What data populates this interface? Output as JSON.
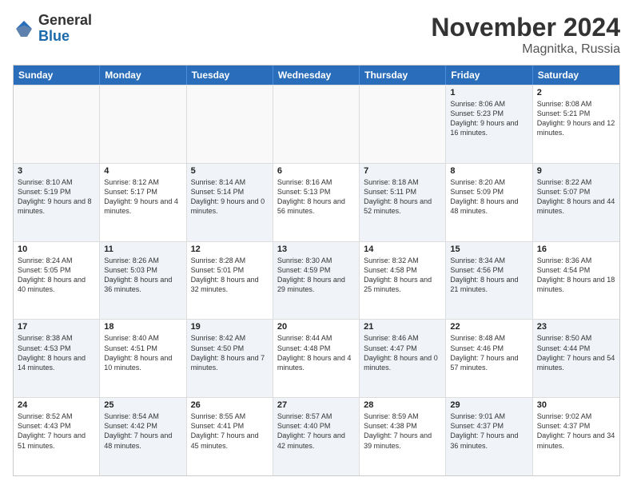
{
  "header": {
    "logo_general": "General",
    "logo_blue": "Blue",
    "month_title": "November 2024",
    "location": "Magnitka, Russia"
  },
  "weekdays": [
    "Sunday",
    "Monday",
    "Tuesday",
    "Wednesday",
    "Thursday",
    "Friday",
    "Saturday"
  ],
  "rows": [
    [
      {
        "day": "",
        "info": "",
        "empty": true
      },
      {
        "day": "",
        "info": "",
        "empty": true
      },
      {
        "day": "",
        "info": "",
        "empty": true
      },
      {
        "day": "",
        "info": "",
        "empty": true
      },
      {
        "day": "",
        "info": "",
        "empty": true
      },
      {
        "day": "1",
        "info": "Sunrise: 8:06 AM\nSunset: 5:23 PM\nDaylight: 9 hours and 16 minutes.",
        "shaded": true
      },
      {
        "day": "2",
        "info": "Sunrise: 8:08 AM\nSunset: 5:21 PM\nDaylight: 9 hours and 12 minutes.",
        "shaded": false
      }
    ],
    [
      {
        "day": "3",
        "info": "Sunrise: 8:10 AM\nSunset: 5:19 PM\nDaylight: 9 hours and 8 minutes.",
        "shaded": true
      },
      {
        "day": "4",
        "info": "Sunrise: 8:12 AM\nSunset: 5:17 PM\nDaylight: 9 hours and 4 minutes.",
        "shaded": false
      },
      {
        "day": "5",
        "info": "Sunrise: 8:14 AM\nSunset: 5:14 PM\nDaylight: 9 hours and 0 minutes.",
        "shaded": true
      },
      {
        "day": "6",
        "info": "Sunrise: 8:16 AM\nSunset: 5:13 PM\nDaylight: 8 hours and 56 minutes.",
        "shaded": false
      },
      {
        "day": "7",
        "info": "Sunrise: 8:18 AM\nSunset: 5:11 PM\nDaylight: 8 hours and 52 minutes.",
        "shaded": true
      },
      {
        "day": "8",
        "info": "Sunrise: 8:20 AM\nSunset: 5:09 PM\nDaylight: 8 hours and 48 minutes.",
        "shaded": false
      },
      {
        "day": "9",
        "info": "Sunrise: 8:22 AM\nSunset: 5:07 PM\nDaylight: 8 hours and 44 minutes.",
        "shaded": true
      }
    ],
    [
      {
        "day": "10",
        "info": "Sunrise: 8:24 AM\nSunset: 5:05 PM\nDaylight: 8 hours and 40 minutes.",
        "shaded": false
      },
      {
        "day": "11",
        "info": "Sunrise: 8:26 AM\nSunset: 5:03 PM\nDaylight: 8 hours and 36 minutes.",
        "shaded": true
      },
      {
        "day": "12",
        "info": "Sunrise: 8:28 AM\nSunset: 5:01 PM\nDaylight: 8 hours and 32 minutes.",
        "shaded": false
      },
      {
        "day": "13",
        "info": "Sunrise: 8:30 AM\nSunset: 4:59 PM\nDaylight: 8 hours and 29 minutes.",
        "shaded": true
      },
      {
        "day": "14",
        "info": "Sunrise: 8:32 AM\nSunset: 4:58 PM\nDaylight: 8 hours and 25 minutes.",
        "shaded": false
      },
      {
        "day": "15",
        "info": "Sunrise: 8:34 AM\nSunset: 4:56 PM\nDaylight: 8 hours and 21 minutes.",
        "shaded": true
      },
      {
        "day": "16",
        "info": "Sunrise: 8:36 AM\nSunset: 4:54 PM\nDaylight: 8 hours and 18 minutes.",
        "shaded": false
      }
    ],
    [
      {
        "day": "17",
        "info": "Sunrise: 8:38 AM\nSunset: 4:53 PM\nDaylight: 8 hours and 14 minutes.",
        "shaded": true
      },
      {
        "day": "18",
        "info": "Sunrise: 8:40 AM\nSunset: 4:51 PM\nDaylight: 8 hours and 10 minutes.",
        "shaded": false
      },
      {
        "day": "19",
        "info": "Sunrise: 8:42 AM\nSunset: 4:50 PM\nDaylight: 8 hours and 7 minutes.",
        "shaded": true
      },
      {
        "day": "20",
        "info": "Sunrise: 8:44 AM\nSunset: 4:48 PM\nDaylight: 8 hours and 4 minutes.",
        "shaded": false
      },
      {
        "day": "21",
        "info": "Sunrise: 8:46 AM\nSunset: 4:47 PM\nDaylight: 8 hours and 0 minutes.",
        "shaded": true
      },
      {
        "day": "22",
        "info": "Sunrise: 8:48 AM\nSunset: 4:46 PM\nDaylight: 7 hours and 57 minutes.",
        "shaded": false
      },
      {
        "day": "23",
        "info": "Sunrise: 8:50 AM\nSunset: 4:44 PM\nDaylight: 7 hours and 54 minutes.",
        "shaded": true
      }
    ],
    [
      {
        "day": "24",
        "info": "Sunrise: 8:52 AM\nSunset: 4:43 PM\nDaylight: 7 hours and 51 minutes.",
        "shaded": false
      },
      {
        "day": "25",
        "info": "Sunrise: 8:54 AM\nSunset: 4:42 PM\nDaylight: 7 hours and 48 minutes.",
        "shaded": true
      },
      {
        "day": "26",
        "info": "Sunrise: 8:55 AM\nSunset: 4:41 PM\nDaylight: 7 hours and 45 minutes.",
        "shaded": false
      },
      {
        "day": "27",
        "info": "Sunrise: 8:57 AM\nSunset: 4:40 PM\nDaylight: 7 hours and 42 minutes.",
        "shaded": true
      },
      {
        "day": "28",
        "info": "Sunrise: 8:59 AM\nSunset: 4:38 PM\nDaylight: 7 hours and 39 minutes.",
        "shaded": false
      },
      {
        "day": "29",
        "info": "Sunrise: 9:01 AM\nSunset: 4:37 PM\nDaylight: 7 hours and 36 minutes.",
        "shaded": true
      },
      {
        "day": "30",
        "info": "Sunrise: 9:02 AM\nSunset: 4:37 PM\nDaylight: 7 hours and 34 minutes.",
        "shaded": false
      }
    ]
  ]
}
